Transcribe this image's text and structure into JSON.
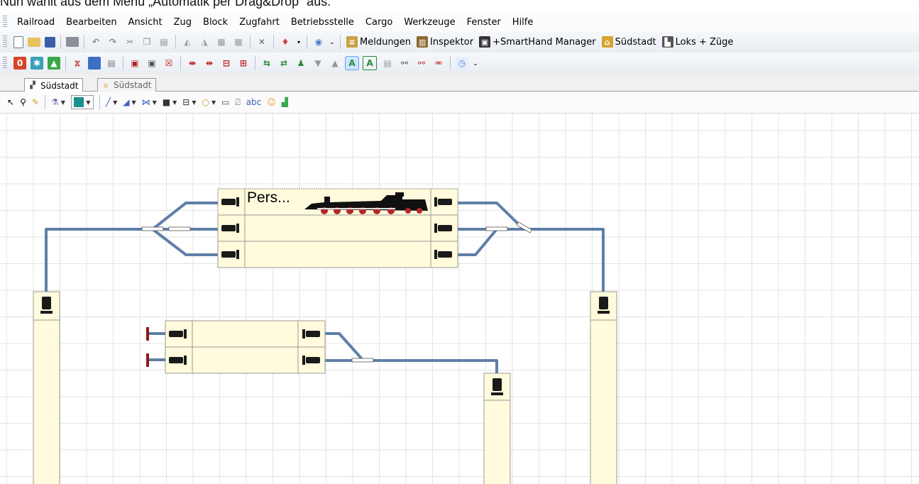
{
  "caption": "Nun wählt aus dem Menü „Automatik per Drag&Drop“ aus.",
  "menu": [
    "Railroad",
    "Bearbeiten",
    "Ansicht",
    "Zug",
    "Block",
    "Zugfahrt",
    "Betriebsstelle",
    "Cargo",
    "Werkzeuge",
    "Fenster",
    "Hilfe"
  ],
  "toolbar1": {
    "messages_label": "Meldungen",
    "inspector_label": "Inspektor",
    "smarthand_label": "+SmartHand Manager",
    "station_label": "Südstadt",
    "locos_label": "Loks + Züge"
  },
  "tabs": [
    {
      "label": "Südstadt",
      "icon": "layout-icon"
    },
    {
      "label": "Südstadt",
      "icon": "station-icon"
    }
  ],
  "blocks": {
    "top_block_label": "Pers..."
  },
  "colors": {
    "track": "#5f7fa8",
    "block_fill": "#fffbdc",
    "buffer_stop": "#8b1a1a",
    "grid": "#e3e3e3"
  }
}
